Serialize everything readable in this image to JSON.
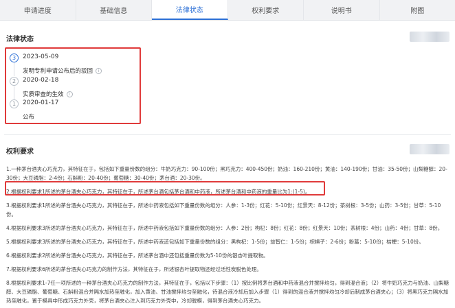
{
  "tabs": [
    {
      "label": "申请进度",
      "active": false
    },
    {
      "label": "基础信息",
      "active": false
    },
    {
      "label": "法律状态",
      "active": true
    },
    {
      "label": "权利要求",
      "active": false
    },
    {
      "label": "说明书",
      "active": false
    },
    {
      "label": "附图",
      "active": false
    }
  ],
  "legal_status": {
    "title": "法律状态",
    "events": [
      {
        "index": "3",
        "date": "2023-05-09",
        "desc": "发明专利申请公布后的驳回"
      },
      {
        "index": "2",
        "date": "2020-02-18",
        "desc": "实质审查的生效"
      },
      {
        "index": "1",
        "date": "2020-01-17",
        "desc": "公布"
      }
    ]
  },
  "claims": {
    "title": "权利要求",
    "items": [
      "1.一种茅台酒夹心巧克力，其特征在于，包括如下重量份数的组分：牛奶巧克力：90-100份；黑巧克力：400-450份；奶油：160-210份；黄油：140-190份；甘油：35-50份；山梨糖醇：20-30份；大豆磷脂：2-4份；石斛粉：20-40份；葡萄糖：30-40份；茅台酒：20-30份。",
      "2.根据权利要求1所述的茅台酒夹心巧克力，其特征在于，所述茅台酒包括茅台酒和中药液，所述茅台酒和中药液的重量比为1:(1-5)。",
      "3.根据权利要求1所述的茅台酒夹心巧克力，其特征在于，所述中药液包括如下重量份数的组分：人参：1-3份；红花：5-10份；红景天：8-12份；茶树根：3-5份；山药：3-5份；甘草：5-10份。",
      "4.根据权利要求3所述的茅台酒夹心巧克力，其特征在于，所述中药液包括如下重量份数的组分：人参：2份；枸杞：8份；红花：8份；红景天：10份；茶树根：4份；山药：4份；甘草：8份。",
      "5.根据权利要求3所述的茅台酒夹心巧克力，其特征在于，所述中药液还包括如下重量份数的组分：黑枸杞：1-5份；益智仁：1-5份；枳椇子：2-6份；粉葛：5-10份；桔梗：5-10份。",
      "6.根据权利要求2所述的茅台酒夹心巧克力，其特征在于，所述茅台酒中还包括重量份数为5-10份的银杏叶提取物。",
      "7.根据权利要求6所述的茅台酒夹心巧克力的制作方法，其特征在于，所述银杏叶提取物还经过活性炭脱色处理。",
      "8.根据权利要求1-7任一项所述的一种茅台酒夹心巧克力的制作方法，其特征在于，包括以下步骤：（1）按比例将茅台酒和中药液混合并搅拌均匀，得到混合液；（2）将牛奶巧克力与奶油、山梨糖醇、大豆磷脂、葡萄糖、石斛粉混合并隔水加热至融化，加入黄油、甘油搅拌均匀至融化，待混合液冷却后加入步骤（1）得到的混合液并搅拌均匀冷却后制成茅台酒夹心；（3）将黑巧克力隔水加热至融化，置于模具中形成巧克力外壳，将茅台酒夹心注入到巧克力外壳中，冷却脱模，得到茅台酒夹心巧克力。"
    ]
  }
}
